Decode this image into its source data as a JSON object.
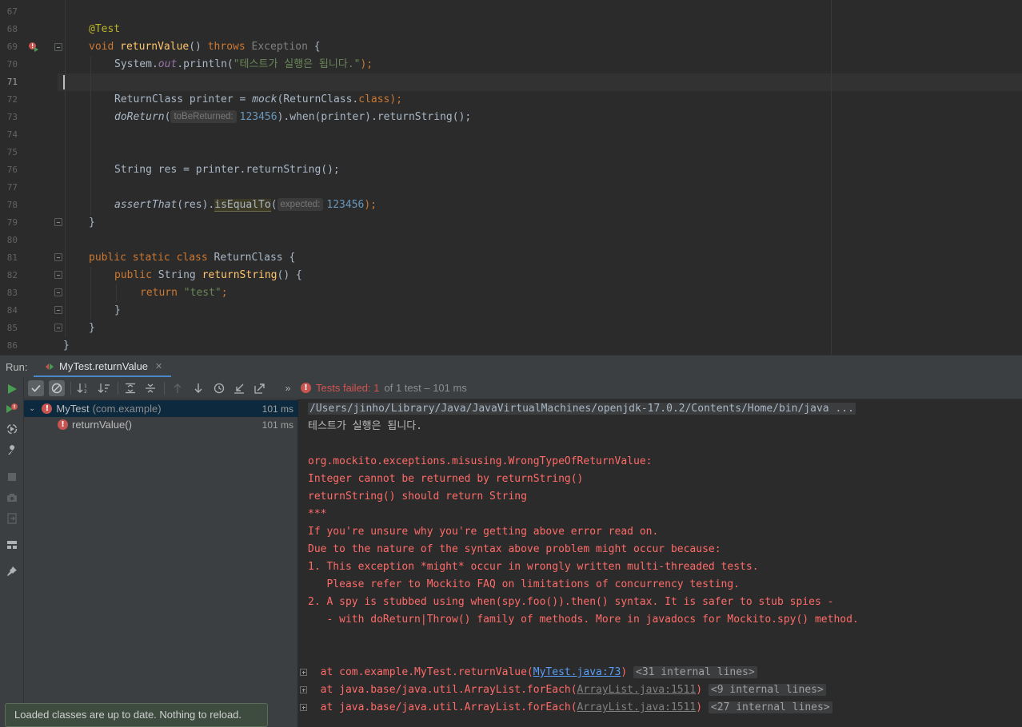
{
  "editor": {
    "line_numbers": [
      "67",
      "68",
      "69",
      "70",
      "71",
      "72",
      "73",
      "74",
      "75",
      "76",
      "77",
      "78",
      "79",
      "80",
      "81",
      "82",
      "83",
      "84",
      "85",
      "86"
    ],
    "code": {
      "l68_annotation": "@Test",
      "l69_void": "void ",
      "l69_method": "returnValue",
      "l69_parens": "() ",
      "l69_throws": "throws",
      "l69_exception": " Exception",
      "l69_brace": " {",
      "l70_system": "System.",
      "l70_out": "out",
      "l70_println": ".println(",
      "l70_string": "\"테스트가 실행은 됩니다.\"",
      "l70_end": ");",
      "l72_decl": "ReturnClass printer = ",
      "l72_mock": "mock",
      "l72_arg": "(ReturnClass.",
      "l72_class": "class",
      "l72_end": ");",
      "l73_doReturn": "doReturn",
      "l73_open": "(",
      "l73_hint": "toBeReturned:",
      "l73_value": "123456",
      "l73_rest": ").when(printer).returnString();",
      "l76_text": "String res = printer.returnString();",
      "l78_assert": "assertThat",
      "l78_res": "(res).",
      "l78_isEqual": "isEqualTo",
      "l78_open": "(",
      "l78_hint": "expected:",
      "l78_value": "123456",
      "l78_end": ");",
      "l79_brace": "}",
      "l81_kw": "public static class",
      "l81_name": " ReturnClass {",
      "l82_kw": "public",
      "l82_type": " String ",
      "l82_method": "returnString",
      "l82_end": "() {",
      "l83_kw": "return",
      "l83_string": " \"test\"",
      "l83_semi": ";",
      "l84_brace": "}",
      "l85_brace": "}",
      "l86_brace": "}"
    }
  },
  "run": {
    "label": "Run:",
    "tab_title": "MyTest.returnValue",
    "status_main": "Tests failed: 1",
    "status_rest": "of 1 test – 101 ms",
    "tree": [
      {
        "name": "MyTest",
        "pkg": "(com.example)",
        "time": "101 ms"
      },
      {
        "name": "returnValue()",
        "time": "101 ms"
      }
    ]
  },
  "console": {
    "cmd": "/Users/jinho/Library/Java/JavaVirtualMachines/openjdk-17.0.2/Contents/Home/bin/java ...",
    "out": "테스트가 실행은 됩니다.",
    "errors": [
      "org.mockito.exceptions.misusing.WrongTypeOfReturnValue:",
      "Integer cannot be returned by returnString()",
      "returnString() should return String",
      "***",
      "If you're unsure why you're getting above error read on.",
      "Due to the nature of the syntax above problem might occur because:",
      "1. This exception *might* occur in wrongly written multi-threaded tests.",
      "   Please refer to Mockito FAQ on limitations of concurrency testing.",
      "2. A spy is stubbed using when(spy.foo()).then() syntax. It is safer to stub spies -",
      "   - with doReturn|Throw() family of methods. More in javadocs for Mockito.spy() method."
    ],
    "stack": [
      {
        "prefix": "  at com.example.MyTest.returnValue(",
        "link": "MyTest.java:73",
        "suffix": ")",
        "internal": "<31 internal lines>"
      },
      {
        "prefix": "  at java.base/java.util.ArrayList.forEach(",
        "link": "ArrayList.java:1511",
        "suffix": ")",
        "internal": "<9 internal lines>"
      },
      {
        "prefix": "  at java.base/java.util.ArrayList.forEach(",
        "link": "ArrayList.java:1511",
        "suffix": ")",
        "internal": "<27 internal lines>"
      }
    ]
  },
  "notification": "Loaded classes are up to date. Nothing to reload."
}
